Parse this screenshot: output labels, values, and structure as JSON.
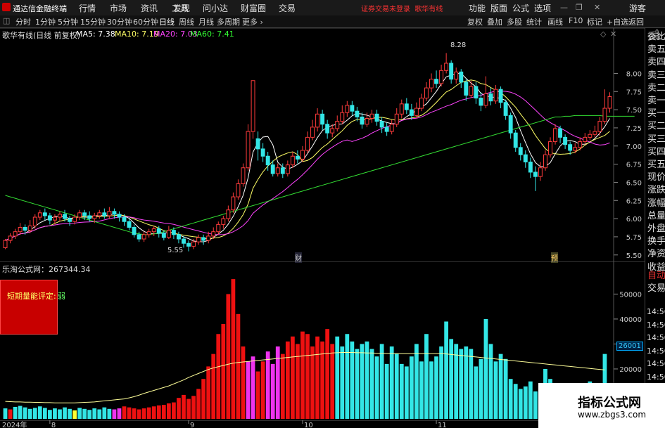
{
  "titlebar": {
    "app_name": "通达信金融终端",
    "menus": [
      "行情",
      "市场",
      "资讯",
      "工具",
      "发现",
      "问小达",
      "财富圈",
      "交易"
    ],
    "login_notice": "证券交易未登录",
    "stock_name": "歌华有线",
    "right_menus": [
      "功能",
      "版面",
      "公式",
      "选项"
    ],
    "guest_label": "游客"
  },
  "tabbar": {
    "periods": [
      "分时",
      "1分钟",
      "5分钟",
      "15分钟",
      "30分钟",
      "60分钟",
      "日线",
      "周线",
      "月线",
      "多周期",
      "更多"
    ],
    "active_period": "日线",
    "right_tabs": [
      "复权",
      "叠加",
      "多股",
      "统计",
      "画线",
      "F10",
      "标记",
      "+自选",
      "返回"
    ]
  },
  "main_chart": {
    "header": "歌华有线(日线 前复权)",
    "indicators": [
      {
        "label": "MA5: 7.38",
        "color": "#ffffff"
      },
      {
        "label": "MA10: 7.19",
        "color": "#ffff66"
      },
      {
        "label": "MA20: 7.03",
        "color": "#ff44ff"
      },
      {
        "label": "MA60: 7.41",
        "color": "#33ff33"
      }
    ],
    "high_label": "8.28",
    "low_label": "5.55",
    "event_labels": [
      "财",
      "预"
    ]
  },
  "volume_chart": {
    "header": "乐淘公式网：267344.34",
    "rating_label": "短期量能评定:",
    "rating_value": "弱",
    "current_value_label": "26001"
  },
  "right_panel": {
    "price_scale_top": "0.",
    "price_scale_top2": "1000",
    "labels": [
      "委比",
      "卖五",
      "卖四",
      "卖三",
      "卖二",
      "卖一",
      "买一",
      "买二",
      "买三",
      "买四",
      "买五",
      "现价",
      "涨跌",
      "涨幅",
      "总量",
      "外盘",
      "换手",
      "净资",
      "收益",
      "自动",
      "交易",
      "14:56",
      "14:56",
      "14:56",
      "14:56",
      "14:56",
      "14:56",
      "14:56",
      "14:56"
    ]
  },
  "watermark": {
    "title": "指标公式网",
    "url": "www.zbgs3.com"
  },
  "chart_data": {
    "type": "candlestick",
    "y_ticks": [
      8.0,
      7.75,
      7.5,
      7.25,
      7.0,
      6.75,
      6.5,
      6.25,
      6.0,
      5.75,
      5.5
    ],
    "ylim": [
      5.43,
      8.43
    ],
    "vol_ticks": [
      50000,
      40000,
      30000,
      20000
    ],
    "vol_ylim": [
      0,
      58000
    ],
    "date_labels": [
      "2024年",
      "8",
      "9",
      "10",
      "11",
      "12",
      "1"
    ],
    "candles": [
      [
        5.6,
        5.7,
        5.72,
        5.58
      ],
      [
        5.7,
        5.76,
        5.8,
        5.66
      ],
      [
        5.76,
        5.82,
        5.86,
        5.72
      ],
      [
        5.82,
        5.88,
        5.94,
        5.78
      ],
      [
        5.88,
        5.84,
        5.92,
        5.78
      ],
      [
        5.84,
        5.9,
        5.98,
        5.8
      ],
      [
        5.9,
        6.02,
        6.06,
        5.86
      ],
      [
        6.02,
        6.08,
        6.12,
        5.98
      ],
      [
        6.08,
        6.04,
        6.14,
        5.98
      ],
      [
        6.04,
        5.98,
        6.08,
        5.92
      ],
      [
        5.98,
        6.02,
        6.06,
        5.92
      ],
      [
        6.02,
        6.06,
        6.1,
        5.96
      ],
      [
        6.06,
        6.0,
        6.12,
        5.96
      ],
      [
        6.0,
        5.96,
        6.04,
        5.9
      ],
      [
        5.96,
        6.02,
        6.06,
        5.92
      ],
      [
        6.02,
        6.08,
        6.12,
        5.98
      ],
      [
        6.08,
        6.04,
        6.12,
        5.98
      ],
      [
        6.04,
        6.0,
        6.1,
        5.96
      ],
      [
        6.0,
        6.04,
        6.08,
        5.94
      ],
      [
        6.04,
        6.08,
        6.12,
        6.0
      ],
      [
        6.08,
        6.04,
        6.14,
        6.0
      ],
      [
        6.04,
        6.1,
        6.16,
        6.0
      ],
      [
        6.1,
        6.06,
        6.14,
        6.0
      ],
      [
        6.06,
        6.02,
        6.1,
        5.96
      ],
      [
        6.02,
        5.96,
        6.06,
        5.9
      ],
      [
        5.96,
        5.88,
        6.0,
        5.84
      ],
      [
        5.88,
        5.78,
        5.92,
        5.74
      ],
      [
        5.78,
        5.72,
        5.82,
        5.68
      ],
      [
        5.72,
        5.78,
        5.82,
        5.68
      ],
      [
        5.78,
        5.82,
        5.86,
        5.74
      ],
      [
        5.82,
        5.86,
        5.9,
        5.76
      ],
      [
        5.86,
        5.8,
        5.9,
        5.74
      ],
      [
        5.8,
        5.74,
        5.84,
        5.7
      ],
      [
        5.74,
        5.84,
        5.9,
        5.72
      ],
      [
        5.84,
        5.78,
        5.88,
        5.72
      ],
      [
        5.78,
        5.72,
        5.82,
        5.66
      ],
      [
        5.72,
        5.66,
        5.76,
        5.6
      ],
      [
        5.66,
        5.62,
        5.7,
        5.55
      ],
      [
        5.62,
        5.68,
        5.72,
        5.58
      ],
      [
        5.68,
        5.74,
        5.78,
        5.64
      ],
      [
        5.74,
        5.7,
        5.78,
        5.64
      ],
      [
        5.7,
        5.76,
        5.82,
        5.66
      ],
      [
        5.76,
        5.82,
        5.88,
        5.72
      ],
      [
        5.82,
        5.92,
        5.96,
        5.78
      ],
      [
        5.92,
        6.0,
        6.04,
        5.86
      ],
      [
        6.0,
        6.12,
        6.18,
        5.96
      ],
      [
        6.12,
        6.3,
        6.36,
        6.08
      ],
      [
        6.3,
        6.48,
        6.54,
        6.26
      ],
      [
        6.48,
        6.7,
        6.76,
        6.44
      ],
      [
        6.7,
        7.2,
        7.3,
        6.66
      ],
      [
        7.2,
        7.9,
        7.9,
        7.1
      ],
      [
        7.1,
        6.96,
        7.2,
        6.8
      ],
      [
        6.96,
        6.86,
        7.04,
        6.78
      ],
      [
        6.86,
        6.74,
        6.92,
        6.66
      ],
      [
        6.74,
        6.62,
        6.8,
        6.58
      ],
      [
        6.62,
        6.7,
        6.76,
        6.58
      ],
      [
        6.7,
        6.62,
        6.76,
        6.56
      ],
      [
        6.62,
        6.74,
        6.8,
        6.58
      ],
      [
        6.74,
        6.86,
        6.92,
        6.7
      ],
      [
        6.86,
        6.82,
        6.94,
        6.76
      ],
      [
        6.82,
        6.94,
        7.0,
        6.78
      ],
      [
        6.94,
        7.12,
        7.2,
        6.9
      ],
      [
        7.12,
        7.26,
        7.36,
        7.08
      ],
      [
        7.26,
        7.44,
        7.52,
        7.2
      ],
      [
        7.44,
        7.3,
        7.5,
        7.22
      ],
      [
        7.3,
        7.18,
        7.36,
        7.1
      ],
      [
        7.18,
        7.24,
        7.3,
        7.12
      ],
      [
        7.24,
        7.34,
        7.42,
        7.2
      ],
      [
        7.34,
        7.46,
        7.56,
        7.3
      ],
      [
        7.46,
        7.56,
        7.62,
        7.4
      ],
      [
        7.56,
        7.48,
        7.62,
        7.42
      ],
      [
        7.48,
        7.4,
        7.54,
        7.34
      ],
      [
        7.4,
        7.3,
        7.46,
        7.24
      ],
      [
        7.3,
        7.38,
        7.46,
        7.26
      ],
      [
        7.38,
        7.44,
        7.5,
        7.32
      ],
      [
        7.44,
        7.34,
        7.5,
        7.28
      ],
      [
        7.34,
        7.26,
        7.4,
        7.18
      ],
      [
        7.26,
        7.2,
        7.32,
        7.14
      ],
      [
        7.2,
        7.3,
        7.36,
        7.16
      ],
      [
        7.3,
        7.44,
        7.52,
        7.26
      ],
      [
        7.44,
        7.58,
        7.64,
        7.38
      ],
      [
        7.58,
        7.5,
        7.66,
        7.44
      ],
      [
        7.5,
        7.42,
        7.58,
        7.36
      ],
      [
        7.42,
        7.52,
        7.6,
        7.38
      ],
      [
        7.52,
        7.66,
        7.72,
        7.48
      ],
      [
        7.66,
        7.8,
        7.88,
        7.62
      ],
      [
        7.8,
        7.92,
        8.0,
        7.74
      ],
      [
        7.92,
        7.86,
        8.04,
        7.8
      ],
      [
        7.86,
        8.04,
        8.12,
        7.82
      ],
      [
        8.04,
        8.14,
        8.28,
        8.0
      ],
      [
        8.14,
        7.92,
        8.18,
        7.86
      ],
      [
        7.92,
        8.02,
        8.08,
        7.86
      ],
      [
        8.02,
        7.88,
        8.06,
        7.8
      ],
      [
        7.88,
        7.7,
        7.92,
        7.62
      ],
      [
        7.7,
        7.82,
        7.9,
        7.66
      ],
      [
        7.82,
        7.66,
        7.88,
        7.58
      ],
      [
        7.66,
        7.56,
        7.74,
        7.48
      ],
      [
        7.56,
        7.72,
        7.96,
        7.52
      ],
      [
        7.72,
        7.62,
        7.8,
        7.56
      ],
      [
        7.62,
        7.78,
        7.84,
        7.58
      ],
      [
        7.78,
        7.6,
        7.82,
        7.52
      ],
      [
        7.6,
        7.42,
        7.64,
        7.36
      ],
      [
        7.42,
        7.18,
        7.46,
        7.1
      ],
      [
        7.18,
        6.98,
        7.22,
        6.92
      ],
      [
        6.98,
        6.88,
        7.04,
        6.8
      ],
      [
        6.88,
        6.78,
        6.94,
        6.7
      ],
      [
        6.78,
        6.64,
        6.84,
        6.56
      ],
      [
        6.64,
        6.58,
        6.72,
        6.38
      ],
      [
        6.58,
        6.7,
        6.78,
        6.52
      ],
      [
        6.7,
        6.88,
        6.94,
        6.66
      ],
      [
        6.88,
        7.06,
        7.12,
        6.84
      ],
      [
        7.06,
        7.24,
        7.3,
        7.02
      ],
      [
        7.24,
        7.12,
        7.28,
        7.04
      ],
      [
        7.12,
        7.02,
        7.16,
        6.96
      ],
      [
        7.02,
        6.94,
        7.06,
        6.88
      ],
      [
        6.94,
        6.98,
        7.04,
        6.9
      ],
      [
        6.98,
        7.06,
        7.12,
        6.94
      ],
      [
        7.06,
        7.12,
        7.18,
        7.02
      ],
      [
        7.12,
        7.16,
        7.22,
        7.08
      ],
      [
        7.16,
        7.2,
        7.28,
        7.12
      ],
      [
        7.2,
        7.34,
        7.4,
        7.14
      ],
      [
        7.34,
        7.52,
        7.78,
        7.3
      ],
      [
        7.52,
        7.68,
        7.74,
        7.46
      ]
    ],
    "ma60": [
      6.32,
      6.3,
      6.28,
      6.26,
      6.24,
      6.22,
      6.2,
      6.18,
      6.16,
      6.14,
      6.12,
      6.1,
      6.08,
      6.06,
      6.04,
      6.02,
      6.0,
      5.98,
      5.96,
      5.94,
      5.92,
      5.9,
      5.88,
      5.86,
      5.84,
      5.82,
      5.8,
      5.79,
      5.78,
      5.78,
      5.79,
      5.8,
      5.82,
      5.84,
      5.86,
      5.88,
      5.9,
      5.92,
      5.94,
      5.96,
      5.98,
      6.0,
      6.02,
      6.04,
      6.06,
      6.08,
      6.1,
      6.12,
      6.14,
      6.16,
      6.18,
      6.2,
      6.22,
      6.24,
      6.26,
      6.28,
      6.3,
      6.32,
      6.34,
      6.36,
      6.38,
      6.4,
      6.42,
      6.44,
      6.46,
      6.48,
      6.5,
      6.52,
      6.54,
      6.56,
      6.58,
      6.6,
      6.62,
      6.64,
      6.66,
      6.68,
      6.7,
      6.72,
      6.74,
      6.76,
      6.78,
      6.8,
      6.82,
      6.84,
      6.86,
      6.88,
      6.9,
      6.92,
      6.94,
      6.96,
      6.98,
      7.0,
      7.02,
      7.04,
      7.06,
      7.08,
      7.1,
      7.12,
      7.14,
      7.16,
      7.18,
      7.2,
      7.22,
      7.24,
      7.26,
      7.28,
      7.3,
      7.32,
      7.34,
      7.36,
      7.38,
      7.4,
      7.4,
      7.41,
      7.41,
      7.42,
      7.42,
      7.42,
      7.42,
      7.42,
      7.42,
      7.41,
      7.41,
      7.41,
      7.41,
      7.41,
      7.41,
      7.41
    ],
    "volumes": [
      [
        4200,
        "cyan"
      ],
      [
        3800,
        "red"
      ],
      [
        4800,
        "cyan"
      ],
      [
        5200,
        "cyan"
      ],
      [
        4600,
        "cyan"
      ],
      [
        4000,
        "cyan"
      ],
      [
        4400,
        "cyan"
      ],
      [
        5000,
        "cyan"
      ],
      [
        4400,
        "cyan"
      ],
      [
        3600,
        "cyan"
      ],
      [
        4200,
        "cyan"
      ],
      [
        3800,
        "cyan"
      ],
      [
        4600,
        "cyan"
      ],
      [
        4000,
        "cyan"
      ],
      [
        3400,
        "yellow"
      ],
      [
        4400,
        "cyan"
      ],
      [
        4000,
        "cyan"
      ],
      [
        3600,
        "cyan"
      ],
      [
        4200,
        "cyan"
      ],
      [
        3800,
        "cyan"
      ],
      [
        4600,
        "cyan"
      ],
      [
        4000,
        "cyan"
      ],
      [
        3800,
        "magenta"
      ],
      [
        4200,
        "magenta"
      ],
      [
        5000,
        "red"
      ],
      [
        4600,
        "red"
      ],
      [
        4200,
        "red"
      ],
      [
        3800,
        "red"
      ],
      [
        4200,
        "red"
      ],
      [
        4600,
        "red"
      ],
      [
        5000,
        "red"
      ],
      [
        5400,
        "red"
      ],
      [
        5600,
        "red"
      ],
      [
        6200,
        "red"
      ],
      [
        6600,
        "red"
      ],
      [
        8400,
        "red"
      ],
      [
        9600,
        "red"
      ],
      [
        8000,
        "red"
      ],
      [
        9200,
        "red"
      ],
      [
        12000,
        "red"
      ],
      [
        16000,
        "red"
      ],
      [
        21000,
        "red"
      ],
      [
        26000,
        "red"
      ],
      [
        34000,
        "red"
      ],
      [
        38000,
        "red"
      ],
      [
        50000,
        "red"
      ],
      [
        56000,
        "red"
      ],
      [
        42000,
        "red"
      ],
      [
        29000,
        "red"
      ],
      [
        23000,
        "magenta"
      ],
      [
        25000,
        "magenta"
      ],
      [
        19000,
        "red"
      ],
      [
        23000,
        "red"
      ],
      [
        27000,
        "magenta"
      ],
      [
        22000,
        "magenta"
      ],
      [
        29000,
        "magenta"
      ],
      [
        26000,
        "red"
      ],
      [
        31000,
        "red"
      ],
      [
        33000,
        "red"
      ],
      [
        30000,
        "red"
      ],
      [
        35000,
        "red"
      ],
      [
        34000,
        "red"
      ],
      [
        29000,
        "red"
      ],
      [
        33000,
        "red"
      ],
      [
        31000,
        "red"
      ],
      [
        36000,
        "red"
      ],
      [
        30000,
        "red"
      ],
      [
        33000,
        "cyan"
      ],
      [
        29000,
        "cyan"
      ],
      [
        34000,
        "cyan"
      ],
      [
        31000,
        "cyan"
      ],
      [
        28000,
        "cyan"
      ],
      [
        30000,
        "cyan"
      ],
      [
        31000,
        "cyan"
      ],
      [
        28000,
        "cyan"
      ],
      [
        25000,
        "cyan"
      ],
      [
        30000,
        "cyan"
      ],
      [
        22000,
        "cyan"
      ],
      [
        29000,
        "cyan"
      ],
      [
        26000,
        "cyan"
      ],
      [
        22000,
        "cyan"
      ],
      [
        21000,
        "cyan"
      ],
      [
        25000,
        "cyan"
      ],
      [
        30000,
        "cyan"
      ],
      [
        23000,
        "cyan"
      ],
      [
        34000,
        "cyan"
      ],
      [
        23000,
        "cyan"
      ],
      [
        25000,
        "cyan"
      ],
      [
        29000,
        "cyan"
      ],
      [
        39000,
        "cyan"
      ],
      [
        32000,
        "cyan"
      ],
      [
        30000,
        "cyan"
      ],
      [
        28000,
        "cyan"
      ],
      [
        29000,
        "cyan"
      ],
      [
        28000,
        "cyan"
      ],
      [
        21000,
        "cyan"
      ],
      [
        24000,
        "cyan"
      ],
      [
        40000,
        "cyan"
      ],
      [
        30000,
        "cyan"
      ],
      [
        23000,
        "cyan"
      ],
      [
        26000,
        "cyan"
      ],
      [
        24000,
        "cyan"
      ],
      [
        16000,
        "cyan"
      ],
      [
        14000,
        "cyan"
      ],
      [
        12000,
        "cyan"
      ],
      [
        13000,
        "cyan"
      ],
      [
        15000,
        "cyan"
      ],
      [
        11000,
        "cyan"
      ],
      [
        9000,
        "cyan"
      ],
      [
        20000,
        "cyan"
      ],
      [
        16000,
        "cyan"
      ],
      [
        14000,
        "cyan"
      ],
      [
        12000,
        "cyan"
      ],
      [
        11000,
        "cyan"
      ],
      [
        9000,
        "cyan"
      ],
      [
        8000,
        "cyan"
      ],
      [
        9000,
        "cyan"
      ],
      [
        14000,
        "cyan"
      ],
      [
        15000,
        "cyan"
      ],
      [
        13000,
        "cyan"
      ],
      [
        12000,
        "cyan"
      ],
      [
        26000,
        "cyan"
      ],
      [
        9000,
        "cyan"
      ]
    ],
    "vol_ma": [
      7000,
      6900,
      6800,
      6800,
      6700,
      6700,
      6600,
      6600,
      6500,
      6500,
      6400,
      6400,
      6400,
      6400,
      6400,
      6500,
      6600,
      6700,
      6800,
      7000,
      7200,
      7400,
      7600,
      7800,
      8000,
      8400,
      8900,
      9500,
      10200,
      10800,
      11400,
      12000,
      12600,
      13200,
      14000,
      14800,
      15600,
      16600,
      17400,
      18200,
      19000,
      19800,
      20400,
      20900,
      21400,
      21900,
      22300,
      22600,
      22800,
      23000,
      23200,
      23400,
      23600,
      23800,
      24000,
      24200,
      24400,
      24600,
      24800,
      25000,
      25200,
      25400,
      25600,
      25800,
      26000,
      26200,
      26400,
      26500,
      26600,
      26600,
      26600,
      26500,
      26500,
      26400,
      26400,
      26300,
      26300,
      26200,
      26200,
      26200,
      26100,
      26100,
      26100,
      26100,
      26100,
      26100,
      26100,
      26100,
      26100,
      26000,
      25800,
      25600,
      25400,
      25200,
      25000,
      24800,
      24600,
      24400,
      24200,
      24000,
      23800,
      23600,
      23400,
      23200,
      23000,
      22800,
      22600,
      22400,
      22200,
      22000,
      21800,
      21600,
      21400,
      21200,
      21000,
      20800,
      20600,
      20400,
      20200,
      20000,
      19800,
      19600
    ]
  }
}
